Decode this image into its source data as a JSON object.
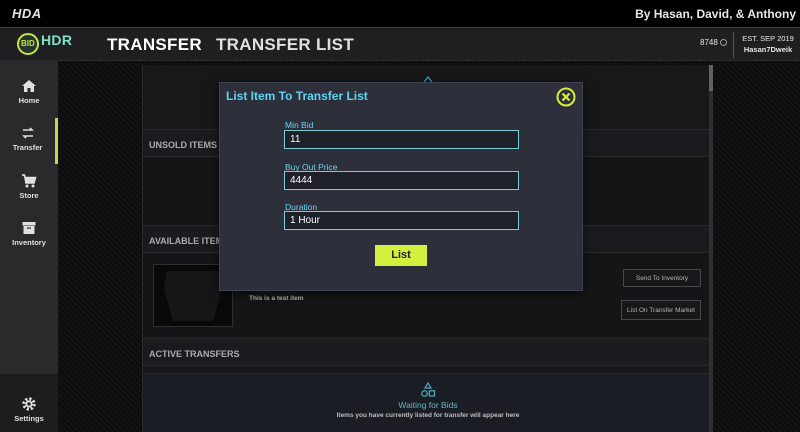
{
  "app": {
    "title": "HDA",
    "credits": "By Hasan, David, & Anthony"
  },
  "header": {
    "logo_text": "HDR",
    "logo_badge": "BID",
    "nav": [
      "TRANSFER",
      "TRANSFER LIST"
    ],
    "coins": "8748",
    "est": "EST. SEP 2019",
    "username": "Hasan7Dweik"
  },
  "sidebar": {
    "items": [
      {
        "label": "Home",
        "icon": "home-icon"
      },
      {
        "label": "Transfer",
        "icon": "transfer-icon",
        "active": true
      },
      {
        "label": "Store",
        "icon": "cart-icon"
      },
      {
        "label": "Inventory",
        "icon": "inventory-icon"
      }
    ],
    "settings_label": "Settings"
  },
  "sections": {
    "unsold": "UNSOLD ITEMS",
    "available": "AVAILABLE ITEMS",
    "active": "ACTIVE TRANSFERS"
  },
  "item": {
    "description": "This is a test item",
    "send_button": "Send To Inventory",
    "list_button": "List On Transfer Market"
  },
  "waiting": {
    "title": "Waiting for Bids",
    "subtitle": "Items you have currently listed for transfer will appear here"
  },
  "modal": {
    "title": "List Item To Transfer List",
    "min_bid_label": "Min Bid",
    "min_bid_value": "11",
    "buyout_label": "Buy Out Price",
    "buyout_value": "4444",
    "duration_label": "Duration",
    "duration_value": "1 Hour",
    "submit": "List"
  },
  "colors": {
    "accent": "#d3f03c",
    "cyan": "#5fd3ef"
  }
}
